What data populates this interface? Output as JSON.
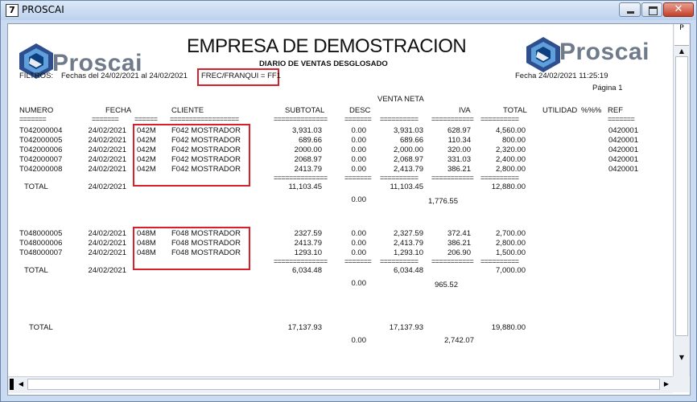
{
  "window": {
    "title": "PROSCAI",
    "icon": "7"
  },
  "brand": {
    "name": "Proscai"
  },
  "report": {
    "company": "EMPRESA DE DEMOSTRACION",
    "subtitle": "DIARIO DE VENTAS  DESGLOSADO",
    "filter_label": "FILTROS:",
    "date_range": "Fechas del 24/02/2021  al 24/02/2021",
    "filter_value": "FREC/FRANQUI = FF1",
    "print_date": "Fecha  24/02/2021 11:25:19",
    "page": "Página 1"
  },
  "columns": {
    "numero": "NUMERO",
    "fecha": "FECHA",
    "cliente": "CLIENTE",
    "subtotal": "SUBTOTAL",
    "desc": "DESC",
    "venta_neta": "VENTA NETA",
    "iva": "IVA",
    "total": "TOTAL",
    "utilidad": "UTILIDAD",
    "pct": "%%%",
    "ref": "REF"
  },
  "groups": [
    {
      "rows": [
        {
          "numero": "T042000004",
          "fecha": "24/02/2021",
          "code": "042M",
          "cliente": "F042 MOSTRADOR",
          "subtotal": "3,931.03",
          "desc": "0.00",
          "neta": "3,931.03",
          "iva": "628.97",
          "total": "4,560.00",
          "ref": "0420001"
        },
        {
          "numero": "T042000005",
          "fecha": "24/02/2021",
          "code": "042M",
          "cliente": "F042 MOSTRADOR",
          "subtotal": "689.66",
          "desc": "0.00",
          "neta": "689.66",
          "iva": "110.34",
          "total": "800.00",
          "ref": "0420001"
        },
        {
          "numero": "T042000006",
          "fecha": "24/02/2021",
          "code": "042M",
          "cliente": "F042 MOSTRADOR",
          "subtotal": "2000.00",
          "desc": "0.00",
          "neta": "2,000.00",
          "iva": "320.00",
          "total": "2,320.00",
          "ref": "0420001"
        },
        {
          "numero": "T042000007",
          "fecha": "24/02/2021",
          "code": "042M",
          "cliente": "F042 MOSTRADOR",
          "subtotal": "2068.97",
          "desc": "0.00",
          "neta": "2,068.97",
          "iva": "331.03",
          "total": "2,400.00",
          "ref": "0420001"
        },
        {
          "numero": "T042000008",
          "fecha": "24/02/2021",
          "code": "042M",
          "cliente": "F042 MOSTRADOR",
          "subtotal": "2413.79",
          "desc": "0.00",
          "neta": "2,413.79",
          "iva": "386.21",
          "total": "2,800.00",
          "ref": "0420001"
        }
      ],
      "total": {
        "label": "TOTAL",
        "fecha": "24/02/2021",
        "subtotal": "11,103.45",
        "desc": "0.00",
        "neta": "11,103.45",
        "iva": "1,776.55",
        "total": "12,880.00"
      }
    },
    {
      "rows": [
        {
          "numero": "T048000005",
          "fecha": "24/02/2021",
          "code": "048M",
          "cliente": "F048 MOSTRADOR",
          "subtotal": "2327.59",
          "desc": "0.00",
          "neta": "2,327.59",
          "iva": "372.41",
          "total": "2,700.00",
          "ref": ""
        },
        {
          "numero": "T048000006",
          "fecha": "24/02/2021",
          "code": "048M",
          "cliente": "F048 MOSTRADOR",
          "subtotal": "2413.79",
          "desc": "0.00",
          "neta": "2,413.79",
          "iva": "386.21",
          "total": "2,800.00",
          "ref": ""
        },
        {
          "numero": "T048000007",
          "fecha": "24/02/2021",
          "code": "048M",
          "cliente": "F048 MOSTRADOR",
          "subtotal": "1293.10",
          "desc": "0.00",
          "neta": "1,293.10",
          "iva": "206.90",
          "total": "1,500.00",
          "ref": ""
        }
      ],
      "total": {
        "label": "TOTAL",
        "fecha": "24/02/2021",
        "subtotal": "6,034.48",
        "desc": "0.00",
        "neta": "6,034.48",
        "iva": "965.52",
        "total": "7,000.00"
      }
    }
  ],
  "grand_total": {
    "label": "TOTAL",
    "subtotal": "17,137.93",
    "desc": "0.00",
    "neta": "17,137.93",
    "iva": "2,742.07",
    "total": "19,880.00"
  },
  "rulers": {
    "numero": "=======",
    "fecha": "=======",
    "cliente_a": "======",
    "cliente_b": "==================",
    "subtotal": "==============",
    "desc": "=======",
    "neta": "==========",
    "iva": "===========",
    "total": "==========",
    "ref": "======="
  },
  "scrollbar": {
    "top_label": "P"
  },
  "icons": {
    "app": "app-icon",
    "minimize": "minimize-icon",
    "maximize": "maximize-icon",
    "close": "close-icon"
  }
}
